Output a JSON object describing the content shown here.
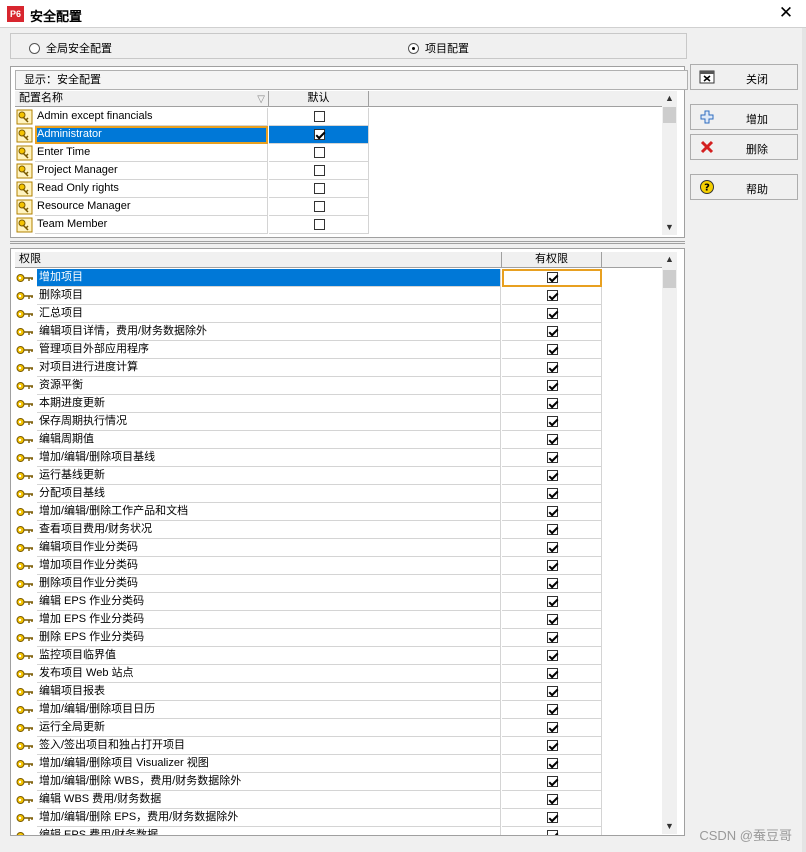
{
  "window": {
    "app_logo": "P6",
    "title": "安全配置",
    "close_glyph": "✕"
  },
  "scope": {
    "global_label": "全局安全配置",
    "project_label": "项目配置",
    "selected": "project"
  },
  "profiles": {
    "display_label": "显示：安全配置",
    "col_name": "配置名称",
    "col_default": "默认",
    "rows": [
      {
        "name": "Admin except financials",
        "default": false
      },
      {
        "name": "Administrator",
        "default": true
      },
      {
        "name": "Enter Time",
        "default": false
      },
      {
        "name": "Project Manager",
        "default": false
      },
      {
        "name": "Read Only rights",
        "default": false
      },
      {
        "name": "Resource Manager",
        "default": false
      },
      {
        "name": "Team Member",
        "default": false
      }
    ],
    "selected_index": 1
  },
  "privileges": {
    "col_name": "权限",
    "col_granted": "有权限",
    "rows": [
      {
        "name": "增加项目",
        "granted": true
      },
      {
        "name": "删除项目",
        "granted": true
      },
      {
        "name": "汇总项目",
        "granted": true
      },
      {
        "name": "编辑项目详情，费用/财务数据除外",
        "granted": true
      },
      {
        "name": "管理项目外部应用程序",
        "granted": true
      },
      {
        "name": "对项目进行进度计算",
        "granted": true
      },
      {
        "name": "资源平衡",
        "granted": true
      },
      {
        "name": "本期进度更新",
        "granted": true
      },
      {
        "name": "保存周期执行情况",
        "granted": true
      },
      {
        "name": "编辑周期值",
        "granted": true
      },
      {
        "name": "增加/编辑/删除项目基线",
        "granted": true
      },
      {
        "name": "运行基线更新",
        "granted": true
      },
      {
        "name": "分配项目基线",
        "granted": true
      },
      {
        "name": "增加/编辑/删除工作产品和文档",
        "granted": true
      },
      {
        "name": "查看项目费用/财务状况",
        "granted": true
      },
      {
        "name": "编辑项目作业分类码",
        "granted": true
      },
      {
        "name": "增加项目作业分类码",
        "granted": true
      },
      {
        "name": "删除项目作业分类码",
        "granted": true
      },
      {
        "name": "编辑 EPS 作业分类码",
        "granted": true
      },
      {
        "name": "增加 EPS 作业分类码",
        "granted": true
      },
      {
        "name": "删除 EPS 作业分类码",
        "granted": true
      },
      {
        "name": "监控项目临界值",
        "granted": true
      },
      {
        "name": "发布项目 Web 站点",
        "granted": true
      },
      {
        "name": "编辑项目报表",
        "granted": true
      },
      {
        "name": "增加/编辑/删除项目日历",
        "granted": true
      },
      {
        "name": "运行全局更新",
        "granted": true
      },
      {
        "name": "签入/签出项目和独占打开项目",
        "granted": true
      },
      {
        "name": "增加/编辑/删除项目 Visualizer 视图",
        "granted": true
      },
      {
        "name": "增加/编辑/删除 WBS，费用/财务数据除外",
        "granted": true
      },
      {
        "name": "编辑 WBS 费用/财务数据",
        "granted": true
      },
      {
        "name": "增加/编辑/删除 EPS，费用/财务数据除外",
        "granted": true
      },
      {
        "name": "编辑 EPS 费用/财务数据",
        "granted": true
      }
    ],
    "selected_index": 0
  },
  "buttons": {
    "close": "关闭",
    "add": "增加",
    "delete": "删除",
    "help": "帮助"
  },
  "watermark": "CSDN @蚕豆哥",
  "colors": {
    "selection": "#0078d7",
    "focus_border": "#e8a020",
    "logo": "#d8262f"
  }
}
